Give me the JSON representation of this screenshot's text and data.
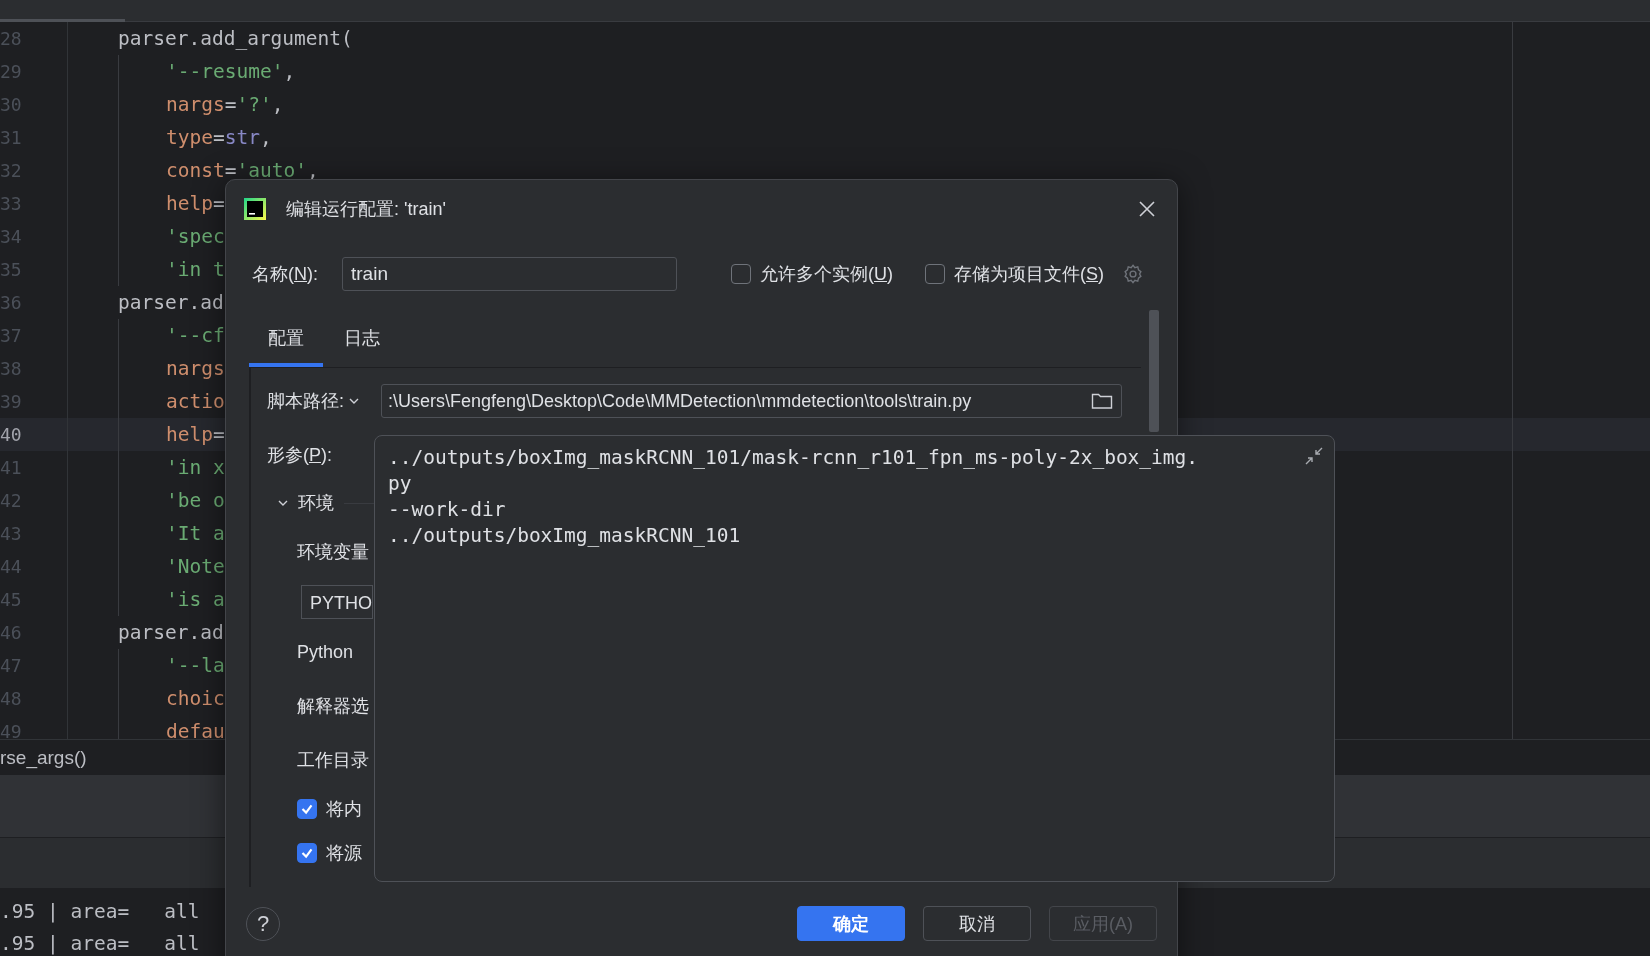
{
  "editor": {
    "lines": [
      {
        "number": "28",
        "current": false,
        "tokens": [
          {
            "kind": "plain",
            "text": "parser.add_argument("
          }
        ],
        "children": [
          {
            "number": "29",
            "current": false,
            "tokens": [
              {
                "kind": "string",
                "text": "'--resume'"
              },
              {
                "kind": "plain",
                "text": ","
              }
            ]
          },
          {
            "number": "30",
            "current": false,
            "tokens": [
              {
                "kind": "keyword",
                "text": "nargs"
              },
              {
                "kind": "plain",
                "text": "="
              },
              {
                "kind": "string",
                "text": "'?'"
              },
              {
                "kind": "plain",
                "text": ","
              }
            ]
          },
          {
            "number": "31",
            "current": false,
            "tokens": [
              {
                "kind": "keyword",
                "text": "type"
              },
              {
                "kind": "plain",
                "text": "="
              },
              {
                "kind": "builtin",
                "text": "str"
              },
              {
                "kind": "plain",
                "text": ","
              }
            ]
          },
          {
            "number": "32",
            "current": false,
            "tokens": [
              {
                "kind": "keyword",
                "text": "const"
              },
              {
                "kind": "plain",
                "text": "="
              },
              {
                "kind": "string",
                "text": "'auto'"
              },
              {
                "kind": "plain",
                "text": ","
              }
            ]
          },
          {
            "number": "33",
            "current": false,
            "tokens": [
              {
                "kind": "keyword",
                "text": "help"
              },
              {
                "kind": "plain",
                "text": "="
              }
            ]
          },
          {
            "number": "34",
            "current": false,
            "tokens": [
              {
                "kind": "string",
                "text": "'spec"
              }
            ]
          },
          {
            "number": "35",
            "current": false,
            "tokens": [
              {
                "kind": "string",
                "text": "'in t"
              }
            ]
          }
        ]
      },
      {
        "number": "36",
        "current": false,
        "tokens": [
          {
            "kind": "plain",
            "text": "parser.ad"
          }
        ],
        "children": [
          {
            "number": "37",
            "current": false,
            "tokens": [
              {
                "kind": "string",
                "text": "'--cf"
              }
            ]
          },
          {
            "number": "38",
            "current": false,
            "tokens": [
              {
                "kind": "keyword",
                "text": "nargs"
              }
            ]
          },
          {
            "number": "39",
            "current": false,
            "tokens": [
              {
                "kind": "keyword",
                "text": "actio"
              }
            ]
          },
          {
            "number": "40",
            "current": true,
            "tokens": [
              {
                "kind": "keyword",
                "text": "help"
              },
              {
                "kind": "plain",
                "text": "="
              }
            ]
          },
          {
            "number": "41",
            "current": false,
            "tokens": [
              {
                "kind": "string",
                "text": "'in x"
              }
            ]
          },
          {
            "number": "42",
            "current": false,
            "tokens": [
              {
                "kind": "string",
                "text": "'be o"
              }
            ]
          },
          {
            "number": "43",
            "current": false,
            "tokens": [
              {
                "kind": "string",
                "text": "'It a"
              }
            ]
          },
          {
            "number": "44",
            "current": false,
            "tokens": [
              {
                "kind": "string",
                "text": "'Note"
              }
            ]
          },
          {
            "number": "45",
            "current": false,
            "tokens": [
              {
                "kind": "string",
                "text": "'is a"
              }
            ]
          }
        ]
      },
      {
        "number": "46",
        "current": false,
        "tokens": [
          {
            "kind": "plain",
            "text": "parser.ad"
          }
        ],
        "children": [
          {
            "number": "47",
            "current": false,
            "tokens": [
              {
                "kind": "string",
                "text": "'--la"
              }
            ]
          },
          {
            "number": "48",
            "current": false,
            "tokens": [
              {
                "kind": "keyword",
                "text": "choic"
              }
            ]
          },
          {
            "number": "49",
            "current": false,
            "tokens": [
              {
                "kind": "keyword",
                "text": "defau"
              }
            ]
          }
        ]
      }
    ],
    "bottom_line": "rse_args()",
    "console": [
      ".95 | area=   all",
      ".95 | area=   all"
    ]
  },
  "dialog": {
    "title": "编辑运行配置: 'train'",
    "name_field": {
      "label": {
        "prefix": "名称(",
        "key": "N",
        "suffix": "):"
      },
      "value": "train"
    },
    "options": [
      {
        "label": {
          "prefix": "允许多个实例(",
          "key": "U",
          "suffix": ")"
        },
        "checked": false
      },
      {
        "label": {
          "prefix": "存储为项目文件(",
          "key": "S",
          "suffix": ")"
        },
        "checked": false
      }
    ],
    "tabs": [
      {
        "label": "配置",
        "selected": true
      },
      {
        "label": "日志",
        "selected": false
      }
    ],
    "script_path": {
      "label": "脚本路径:",
      "value": ":\\Users\\Fengfeng\\Desktop\\Code\\MMDetection\\mmdetection\\tools\\train.py"
    },
    "parameters": {
      "label": {
        "prefix": "形参(",
        "key": "P",
        "suffix": "):"
      },
      "lines": [
        "../outputs/boxImg_maskRCNN_101/mask-rcnn_r101_fpn_ms-poly-2x_box_img.",
        "py",
        "--work-dir",
        "../outputs/boxImg_maskRCNN_101"
      ]
    },
    "environment": {
      "label": "环境",
      "expanded": true,
      "items": [
        {
          "kind": "label",
          "text": "环境变量"
        },
        {
          "kind": "field",
          "value": "PYTHO"
        },
        {
          "kind": "label",
          "text": "Python"
        },
        {
          "kind": "label",
          "text": "解释器选"
        },
        {
          "kind": "label",
          "text": "工作目录"
        },
        {
          "kind": "checkbox",
          "text": "将内",
          "checked": true
        },
        {
          "kind": "checkbox",
          "text": "将源",
          "checked": true
        }
      ]
    },
    "help": "?",
    "buttons": [
      {
        "label": "确定",
        "kind": "primary",
        "disabled": false
      },
      {
        "label": "取消",
        "kind": "secondary",
        "disabled": false
      },
      {
        "label": "应用(A)",
        "kind": "secondary",
        "disabled": true
      }
    ]
  }
}
